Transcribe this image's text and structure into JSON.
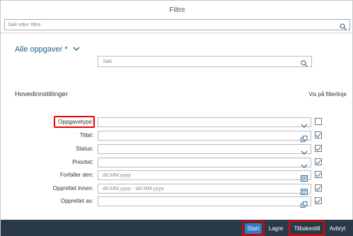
{
  "dialog": {
    "title": "Filtre",
    "search": {
      "placeholder": "Søk etter filtre"
    }
  },
  "variant": {
    "label": "Alle oppgaver *"
  },
  "basic_search": {
    "placeholder": "Søk"
  },
  "section": {
    "title": "Hovedinnstillinger",
    "show_in_filterbar": "Vis på filterlinje"
  },
  "filters": [
    {
      "label": "Oppgavetype:",
      "value": "",
      "control": "dropdown",
      "in_filterbar": false
    },
    {
      "label": "Tittel:",
      "value": "",
      "control": "value-help",
      "in_filterbar": true
    },
    {
      "label": "Status:",
      "value": "",
      "control": "dropdown",
      "in_filterbar": true
    },
    {
      "label": "Prioritet:",
      "value": "",
      "control": "dropdown",
      "in_filterbar": true
    },
    {
      "label": "Forfaller den:",
      "value": "dd.MM.yyyy",
      "control": "date",
      "in_filterbar": true
    },
    {
      "label": "Opprettet innen:",
      "value": "dd.MM.yyyy - dd.MM.yyyy",
      "control": "date",
      "in_filterbar": true
    },
    {
      "label": "Opprettet av:",
      "value": "",
      "control": "value-help",
      "in_filterbar": true
    }
  ],
  "footer": {
    "start": "Start",
    "save": "Lagre",
    "reset": "Tilbakestill",
    "cancel": "Avbryt"
  },
  "colors": {
    "accent": "#1a5c8c",
    "primary_button": "#3a7cc4",
    "footer_bg": "#2b3a4a",
    "highlight": "#e00000"
  }
}
